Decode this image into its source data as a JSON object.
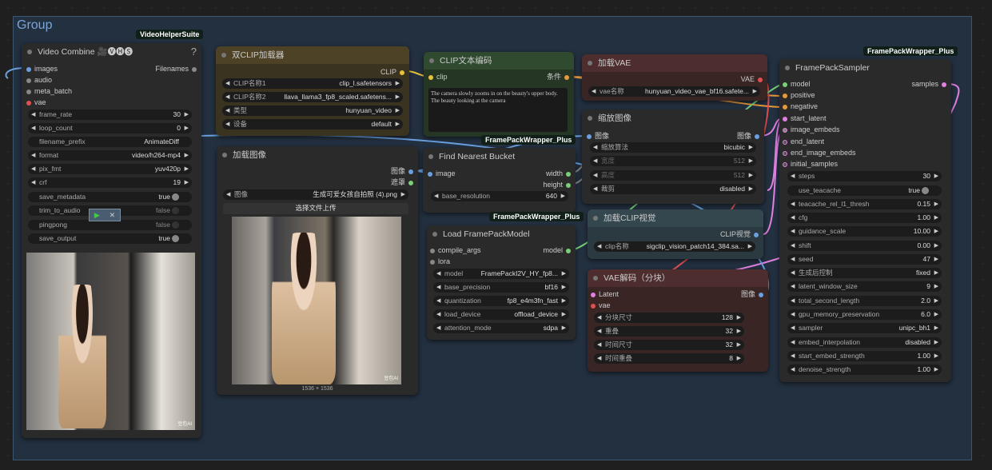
{
  "group": {
    "title": "Group"
  },
  "tags": {
    "vhs": "VideoHelperSuite",
    "fpw1": "FramePackWrapper_Plus",
    "fpw2": "FramePackWrapper_Plus",
    "fpw3": "FramePackWrapper_Plus"
  },
  "video_combine": {
    "title": "Video Combine 🎥🅥🅗🅢",
    "help": "?",
    "inputs": [
      "images",
      "audio",
      "meta_batch",
      "vae"
    ],
    "output": "Filenames",
    "widgets": [
      {
        "label": "frame_rate",
        "value": "30"
      },
      {
        "label": "loop_count",
        "value": "0"
      },
      {
        "label": "filename_prefix",
        "value": "AnimateDiff"
      },
      {
        "label": "format",
        "value": "video/h264-mp4"
      },
      {
        "label": "pix_fmt",
        "value": "yuv420p"
      },
      {
        "label": "crf",
        "value": "19"
      },
      {
        "label": "save_metadata",
        "value": "true"
      },
      {
        "label": "trim_to_audio",
        "value": "false"
      },
      {
        "label": "pingpong",
        "value": "false"
      },
      {
        "label": "save_output",
        "value": "true"
      }
    ],
    "watermark": "豆包AI"
  },
  "dual_clip": {
    "title": "双CLIP加载器",
    "output": "CLIP",
    "widgets": [
      {
        "label": "CLIP名称1",
        "value": "clip_l.safetensors"
      },
      {
        "label": "CLIP名称2",
        "value": "llava_llama3_fp8_scaled.safetens..."
      },
      {
        "label": "类型",
        "value": "hunyuan_video"
      },
      {
        "label": "设备",
        "value": "default"
      }
    ]
  },
  "clip_text": {
    "title": "CLIP文本编码",
    "input": "clip",
    "output": "条件",
    "text": "The camera slowly zooms in on the beauty's upper body. The beauty looking at the camera"
  },
  "load_vae": {
    "title": "加载VAE",
    "output": "VAE",
    "widget": {
      "label": "vae名称",
      "value": "hunyuan_video_vae_bf16.safete..."
    }
  },
  "resize": {
    "title": "缩放图像",
    "input": "图像",
    "output": "图像",
    "widgets": [
      {
        "label": "缩放算法",
        "value": "bicubic"
      },
      {
        "label": "宽度",
        "value": "512"
      },
      {
        "label": "高度",
        "value": "512"
      },
      {
        "label": "裁剪",
        "value": "disabled"
      }
    ]
  },
  "load_image": {
    "title": "加载图像",
    "outputs": [
      "图像",
      "遮罩"
    ],
    "widget": {
      "label": "图像",
      "value": "生成可爱女孩自拍照 (4).png"
    },
    "upload": "选择文件上传",
    "size": "1536 × 1536",
    "watermark": "豆包AI"
  },
  "bucket": {
    "title": "Find Nearest Bucket",
    "input": "image",
    "outputs": [
      "width",
      "height"
    ],
    "widget": {
      "label": "base_resolution",
      "value": "640"
    }
  },
  "load_clip_vision": {
    "title": "加载CLIP视觉",
    "output": "CLIP视觉",
    "widget": {
      "label": "clip名称",
      "value": "sigclip_vision_patch14_384.sa..."
    }
  },
  "load_fp_model": {
    "title": "Load FramePackModel",
    "inputs": [
      "compile_args",
      "lora"
    ],
    "output": "model",
    "widgets": [
      {
        "label": "model",
        "value": "FramePackI2V_HY_fp8..."
      },
      {
        "label": "base_precision",
        "value": "bf16"
      },
      {
        "label": "quantization",
        "value": "fp8_e4m3fn_fast"
      },
      {
        "label": "load_device",
        "value": "offload_device"
      },
      {
        "label": "attention_mode",
        "value": "sdpa"
      }
    ]
  },
  "vae_decode": {
    "title": "VAE解码（分块）",
    "inputs": [
      "Latent",
      "vae"
    ],
    "output": "图像",
    "widgets": [
      {
        "label": "分块尺寸",
        "value": "128"
      },
      {
        "label": "重叠",
        "value": "32"
      },
      {
        "label": "时间尺寸",
        "value": "32"
      },
      {
        "label": "时间重叠",
        "value": "8"
      }
    ]
  },
  "sampler": {
    "title": "FramePackSampler",
    "output": "samples",
    "inputs": [
      "model",
      "positive",
      "negative",
      "start_latent",
      "image_embeds",
      "end_latent",
      "end_image_embeds",
      "initial_samples"
    ],
    "widgets": [
      {
        "label": "steps",
        "value": "30"
      },
      {
        "label": "use_teacache",
        "value": "true"
      },
      {
        "label": "teacache_rel_l1_thresh",
        "value": "0.15"
      },
      {
        "label": "cfg",
        "value": "1.00"
      },
      {
        "label": "guidance_scale",
        "value": "10.00"
      },
      {
        "label": "shift",
        "value": "0.00"
      },
      {
        "label": "seed",
        "value": "47"
      },
      {
        "label": "生成后控制",
        "value": "fixed"
      },
      {
        "label": "latent_window_size",
        "value": "9"
      },
      {
        "label": "total_second_length",
        "value": "2.0"
      },
      {
        "label": "gpu_memory_preservation",
        "value": "6.0"
      },
      {
        "label": "sampler",
        "value": "unipc_bh1"
      },
      {
        "label": "embed_interpolation",
        "value": "disabled"
      },
      {
        "label": "start_embed_strength",
        "value": "1.00"
      },
      {
        "label": "denoise_strength",
        "value": "1.00"
      }
    ]
  }
}
